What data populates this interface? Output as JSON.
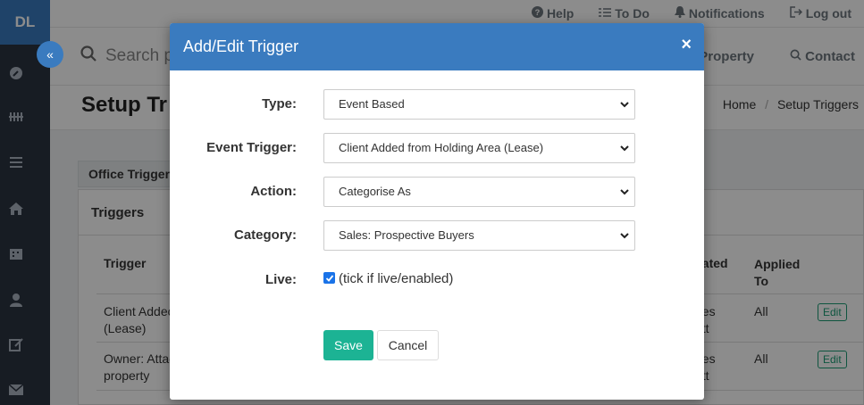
{
  "sidebar": {
    "brand": "DL"
  },
  "topbar": {
    "help": "Help",
    "todo": "To Do",
    "notifications": "Notifications",
    "logout": "Log out"
  },
  "searchbar": {
    "placeholder": "Search p",
    "property": "Property",
    "contact": "Contact"
  },
  "page": {
    "title": "Setup Tr",
    "breadcrumb_home": "Home",
    "breadcrumb_current": "Setup Triggers"
  },
  "office_tab": "Office Trigger",
  "card": {
    "title": "Triggers",
    "headers": {
      "trigger": "Trigger",
      "created": "eated",
      "applied_line1": "Applied",
      "applied_line2": "To"
    },
    "rows": [
      {
        "trigger_l1": "Client Addec",
        "trigger_l2": "(Lease)",
        "created_l1": "nes",
        "created_l2": "ott",
        "applied": "All",
        "edit": "Edit"
      },
      {
        "trigger_l1": "Owner: Attac",
        "trigger_l2": "property",
        "created_l1": "nes",
        "created_l2": "ott",
        "applied": "All",
        "edit": "Edit"
      }
    ]
  },
  "modal": {
    "title": "Add/Edit Trigger",
    "close": "×",
    "fields": {
      "type": {
        "label": "Type:",
        "value": "Event Based"
      },
      "event_trigger": {
        "label": "Event Trigger:",
        "value": "Client Added from Holding Area (Lease)"
      },
      "action": {
        "label": "Action:",
        "value": "Categorise As"
      },
      "category": {
        "label": "Category:",
        "value": "Sales: Prospective Buyers"
      },
      "live": {
        "label": "Live:",
        "checked": true,
        "hint": "(tick if live/enabled)"
      }
    },
    "save": "Save",
    "cancel": "Cancel"
  },
  "colors": {
    "primary": "#3a7bbf",
    "success": "#1cb394",
    "sidebar": "#2b3340"
  }
}
